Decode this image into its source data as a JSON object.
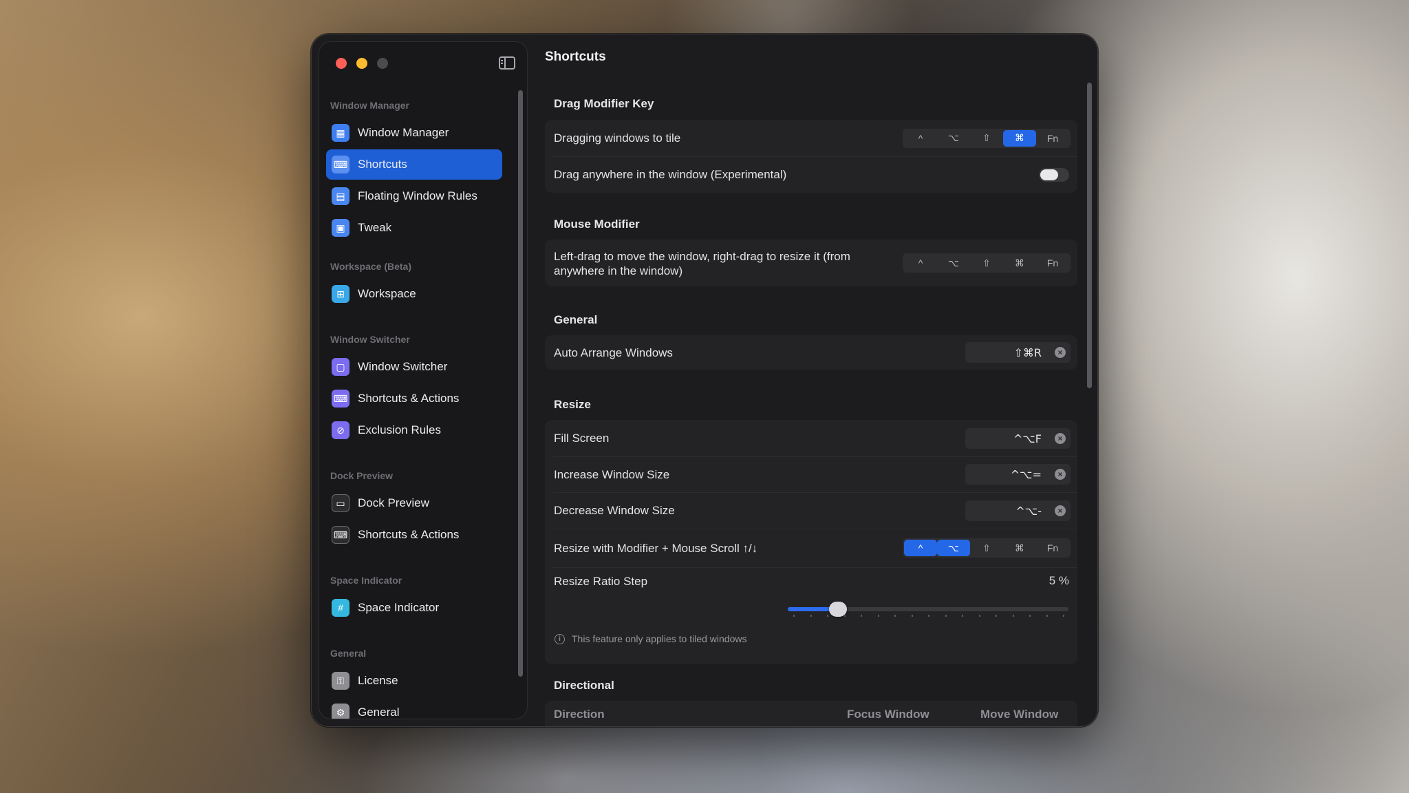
{
  "colors": {
    "accent": "#2468e8",
    "sidebar_active": "#1f5fd6",
    "window_bg": "#1c1c1e",
    "close": "#fe5f57",
    "minimize": "#febc2e"
  },
  "window": {
    "title": "Shortcuts"
  },
  "sidebar": {
    "sections": [
      {
        "title": "Window Manager",
        "items": [
          {
            "label": "Window Manager",
            "icon": "window-manager-icon",
            "active": false
          },
          {
            "label": "Shortcuts",
            "icon": "keyboard-icon",
            "active": true
          },
          {
            "label": "Floating Window Rules",
            "icon": "document-icon",
            "active": false
          },
          {
            "label": "Tweak",
            "icon": "tweak-icon",
            "active": false
          }
        ]
      },
      {
        "title": "Workspace (Beta)",
        "items": [
          {
            "label": "Workspace",
            "icon": "grid-icon",
            "active": false
          }
        ]
      },
      {
        "title": "Window Switcher",
        "items": [
          {
            "label": "Window Switcher",
            "icon": "window-switcher-icon",
            "active": false
          },
          {
            "label": "Shortcuts & Actions",
            "icon": "keyboard-icon",
            "active": false
          },
          {
            "label": "Exclusion Rules",
            "icon": "exclusion-icon",
            "active": false
          }
        ]
      },
      {
        "title": "Dock Preview",
        "items": [
          {
            "label": "Dock Preview",
            "icon": "dock-icon",
            "active": false
          },
          {
            "label": "Shortcuts & Actions",
            "icon": "keyboard-icon",
            "active": false
          }
        ]
      },
      {
        "title": "Space Indicator",
        "items": [
          {
            "label": "Space Indicator",
            "icon": "hash-icon",
            "active": false
          }
        ]
      },
      {
        "title": "General",
        "items": [
          {
            "label": "License",
            "icon": "key-icon",
            "active": false
          },
          {
            "label": "General",
            "icon": "gear-icon",
            "active": false
          }
        ]
      }
    ]
  },
  "modifier_labels": [
    "^",
    "⌥",
    "⇧",
    "⌘",
    "Fn"
  ],
  "drag_modifier": {
    "title": "Drag Modifier Key",
    "tile_label": "Dragging windows to tile",
    "tile_selected": [
      false,
      false,
      false,
      true,
      false
    ],
    "anywhere_label": "Drag anywhere in the window (Experimental)",
    "anywhere_enabled": false
  },
  "mouse_modifier": {
    "title": "Mouse Modifier",
    "label_line1": "Left-drag to move the window, right-drag to resize it (from",
    "label_line2": "anywhere in the window)",
    "selected": [
      false,
      false,
      false,
      false,
      false
    ]
  },
  "general": {
    "title": "General",
    "rows": [
      {
        "label": "Auto Arrange Windows",
        "shortcut": "⇧⌘R"
      }
    ]
  },
  "resize": {
    "title": "Resize",
    "rows": [
      {
        "label": "Fill Screen",
        "shortcut": "^⌥F"
      },
      {
        "label": "Increase Window Size",
        "shortcut": "^⌥="
      },
      {
        "label": "Decrease Window Size",
        "shortcut": "^⌥-"
      }
    ],
    "scroll_label": "Resize with Modifier + Mouse Scroll ↑/↓",
    "scroll_selected": [
      true,
      true,
      false,
      false,
      false
    ],
    "ratio_label": "Resize Ratio Step",
    "ratio_value": "5 %",
    "ratio_fraction": 0.18,
    "info": "This feature only applies to tiled windows"
  },
  "directional": {
    "title": "Directional",
    "columns": [
      "Direction",
      "Focus Window",
      "Move Window"
    ]
  }
}
